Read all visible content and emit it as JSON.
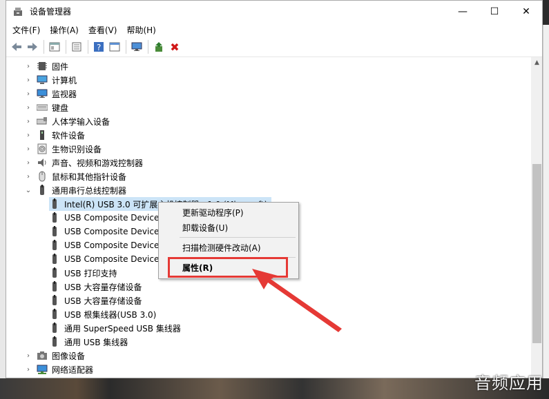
{
  "window": {
    "title": "设备管理器",
    "controls": {
      "minimize": "—",
      "maximize": "☐",
      "close": "✕"
    }
  },
  "menubar": {
    "items": [
      "文件(F)",
      "操作(A)",
      "查看(V)",
      "帮助(H)"
    ]
  },
  "toolbar": {
    "icons": [
      "back-icon",
      "forward-icon",
      "properties-pane-icon",
      "list-icon",
      "help-icon",
      "view-icon",
      "monitor-scan-icon",
      "update-driver-icon",
      "uninstall-icon"
    ]
  },
  "tree": {
    "categories_top": [
      {
        "label": "固件",
        "icon": "firmware-icon"
      },
      {
        "label": "计算机",
        "icon": "computer-icon"
      },
      {
        "label": "监视器",
        "icon": "monitor-icon"
      },
      {
        "label": "键盘",
        "icon": "keyboard-icon"
      },
      {
        "label": "人体学输入设备",
        "icon": "hid-icon"
      },
      {
        "label": "软件设备",
        "icon": "software-device-icon"
      },
      {
        "label": "生物识别设备",
        "icon": "fingerprint-icon"
      },
      {
        "label": "声音、视频和游戏控制器",
        "icon": "speaker-icon"
      },
      {
        "label": "鼠标和其他指针设备",
        "icon": "mouse-icon"
      }
    ],
    "expanded_category": {
      "label": "通用串行总线控制器",
      "icon": "usb-icon"
    },
    "usb_children": [
      "Intel(R) USB 3.0 可扩展主机控制器 - 1.0 (Microsoft)",
      "USB Composite Device",
      "USB Composite Device",
      "USB Composite Device",
      "USB Composite Device",
      "USB 打印支持",
      "USB 大容量存储设备",
      "USB 大容量存储设备",
      "USB 根集线器(USB 3.0)",
      "通用 SuperSpeed USB 集线器",
      "通用 USB 集线器"
    ],
    "categories_bottom": [
      {
        "label": "图像设备",
        "icon": "camera-icon"
      },
      {
        "label": "网络适配器",
        "icon": "network-icon"
      }
    ]
  },
  "context_menu": {
    "items": [
      "更新驱动程序(P)",
      "卸载设备(U)",
      "扫描检测硬件改动(A)",
      "属性(R)"
    ]
  },
  "watermark": "音频应用",
  "colors": {
    "highlight_red": "#e53935",
    "selection": "#cce4f7"
  }
}
